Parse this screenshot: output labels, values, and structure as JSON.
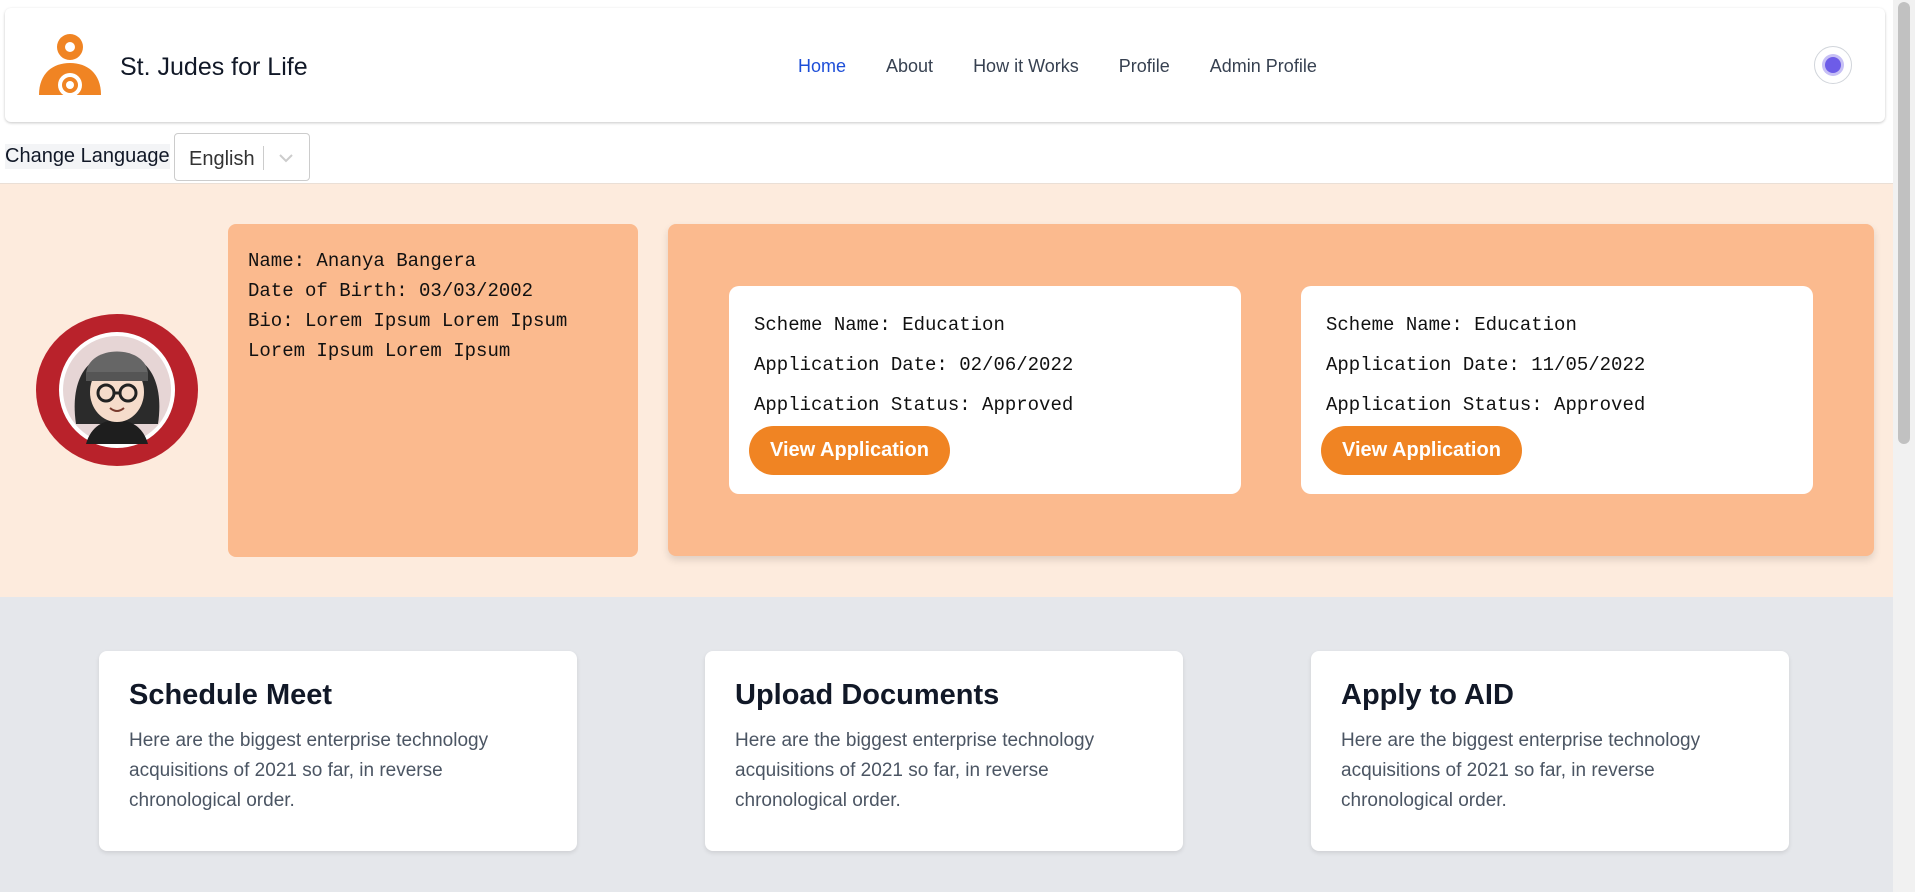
{
  "header": {
    "brand": "St. Judes for Life",
    "nav": [
      {
        "label": "Home",
        "active": true
      },
      {
        "label": "About",
        "active": false
      },
      {
        "label": "How it Works",
        "active": false
      },
      {
        "label": "Profile",
        "active": false
      },
      {
        "label": "Admin Profile",
        "active": false
      }
    ],
    "theme_icon": "theme-toggle-icon"
  },
  "language": {
    "label": "Change Language",
    "selected": "English"
  },
  "profile": {
    "name": "Name: Ananya Bangera",
    "dob": "Date of Birth: 03/03/2002",
    "bio": "Bio: Lorem Ipsum Lorem Ipsum Lorem Ipsum Lorem Ipsum"
  },
  "applications": [
    {
      "scheme": "Scheme Name: Education",
      "date": "Application Date: 02/06/2022",
      "status": "Application Status: Approved",
      "button": "View Application"
    },
    {
      "scheme": "Scheme Name: Education",
      "date": "Application Date: 11/05/2022",
      "status": "Application Status: Approved",
      "button": "View Application"
    }
  ],
  "features": [
    {
      "title": "Schedule Meet",
      "text": "Here are the biggest enterprise technology acquisitions of 2021 so far, in reverse chronological order."
    },
    {
      "title": "Upload Documents",
      "text": "Here are the biggest enterprise technology acquisitions of 2021 so far, in reverse chronological order."
    },
    {
      "title": "Apply to AID",
      "text": "Here are the biggest enterprise technology acquisitions of 2021 so far, in reverse chronological order."
    }
  ],
  "colors": {
    "accent": "#f08423",
    "nav_active": "#1d4ed8",
    "band_bg": "#fdebdd",
    "card_bg": "#fbba8e"
  }
}
